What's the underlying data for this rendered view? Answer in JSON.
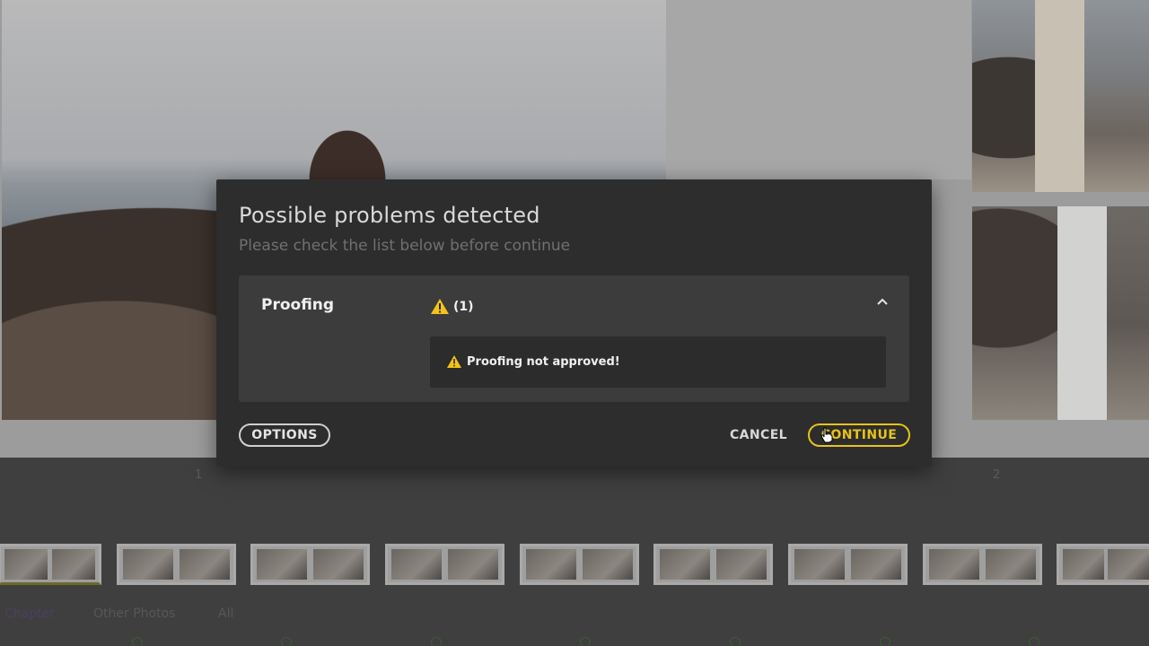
{
  "background": {
    "page_numbers": [
      "1",
      "2"
    ],
    "tabs": [
      "Chapter",
      "Other Photos",
      "All"
    ],
    "thumbnail_count": 9
  },
  "dialog": {
    "title": "Possible problems detected",
    "subtitle": "Please check the list below before continue",
    "section": {
      "title": "Proofing",
      "count": "(1)",
      "expanded": true,
      "issue": "Proofing not approved!"
    },
    "buttons": {
      "options": "OPTIONS",
      "cancel": "CANCEL",
      "continue": "CONTINUE"
    }
  },
  "colors": {
    "accent": "#e8c21b",
    "warning": "#f2c318",
    "dialog_bg": "#2d2d2d",
    "panel_bg": "#3c3c3c"
  },
  "icons": {
    "warning": "warning-triangle-icon",
    "collapse": "chevron-up-icon",
    "cursor": "hand-pointer-icon"
  }
}
